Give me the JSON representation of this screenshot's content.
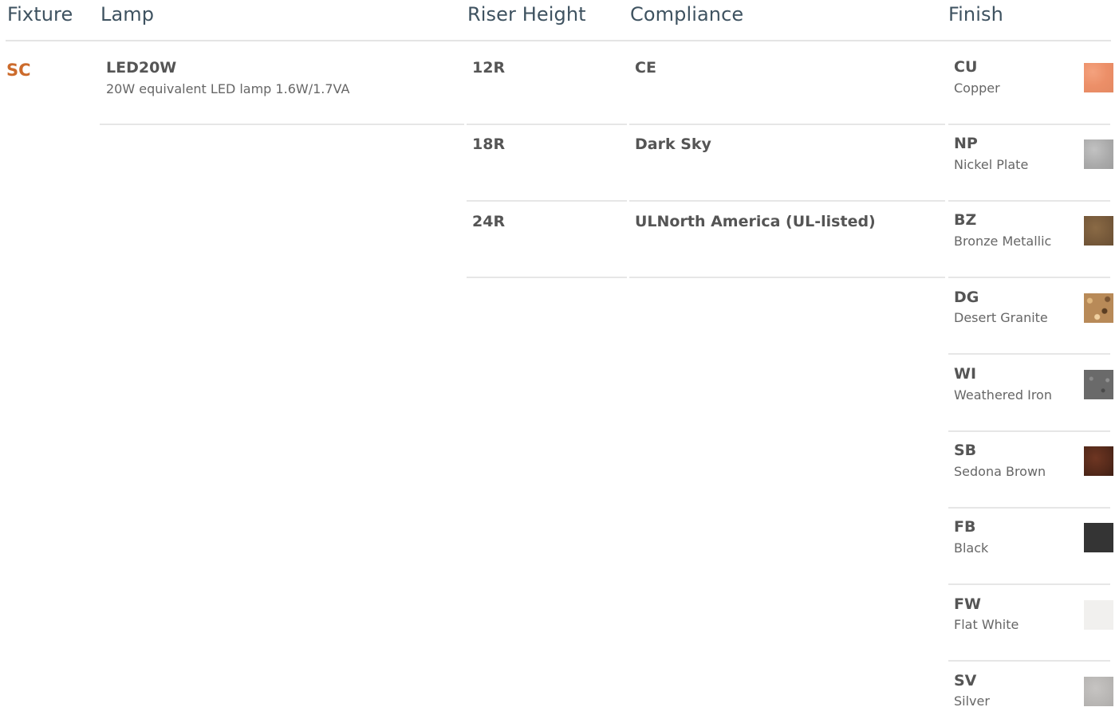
{
  "headers": {
    "fixture": "Fixture",
    "lamp": "Lamp",
    "riser_height": "Riser Height",
    "compliance": "Compliance",
    "finish": "Finish"
  },
  "fixture": {
    "code": "SC",
    "code_color": "#cc6b2c"
  },
  "lamp": {
    "code": "LED20W",
    "description": "20W equivalent LED lamp 1.6W/1.7VA"
  },
  "riser_heights": [
    {
      "code": "12R"
    },
    {
      "code": "18R"
    },
    {
      "code": "24R"
    }
  ],
  "compliance": [
    {
      "label": "CE"
    },
    {
      "label": "Dark Sky"
    },
    {
      "label": "ULNorth America (UL-listed)"
    }
  ],
  "finishes": [
    {
      "code": "CU",
      "name": "Copper",
      "color": "#ec8f68"
    },
    {
      "code": "NP",
      "name": "Nickel Plate",
      "color": "#a9a9a9"
    },
    {
      "code": "BZ",
      "name": "Bronze Metallic",
      "color": "#76593a"
    },
    {
      "code": "DG",
      "name": "Desert Granite",
      "color": "#b88a58"
    },
    {
      "code": "WI",
      "name": "Weathered Iron",
      "color": "#6a6a6a"
    },
    {
      "code": "SB",
      "name": "Sedona Brown",
      "color": "#54291a"
    },
    {
      "code": "FB",
      "name": "Black",
      "color": "#343434"
    },
    {
      "code": "FW",
      "name": "Flat White",
      "color": "#f1f0ee"
    },
    {
      "code": "SV",
      "name": "Silver",
      "color": "#b6b4b2"
    }
  ],
  "header_color": "#3e5260"
}
